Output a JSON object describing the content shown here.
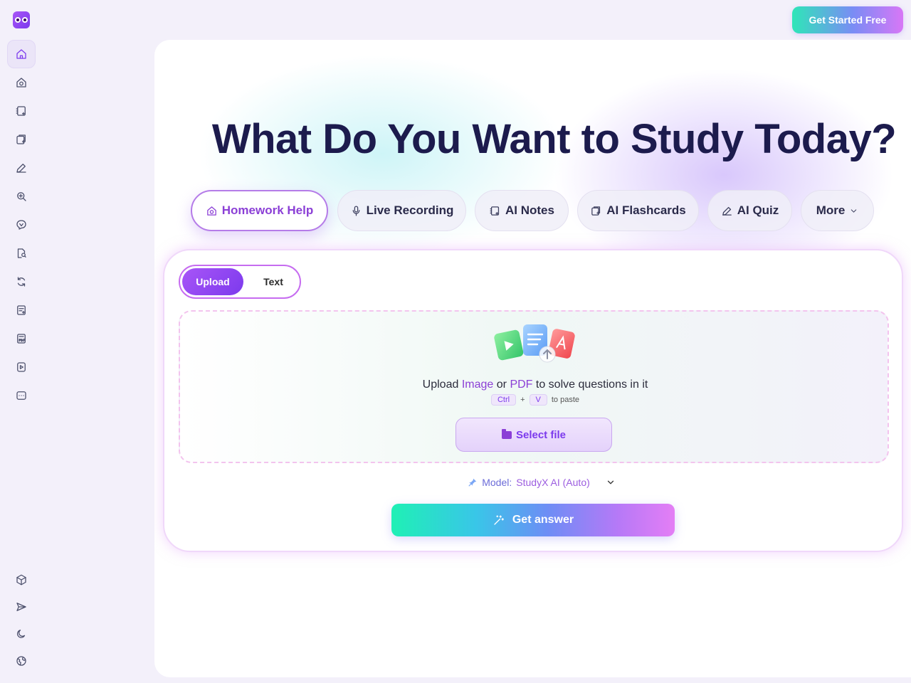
{
  "header": {
    "cta_label": "Get Started Free"
  },
  "sidebar": {
    "items": [
      {
        "icon": "home-icon",
        "active": true
      },
      {
        "icon": "homework-camera-icon"
      },
      {
        "icon": "notes-icon"
      },
      {
        "icon": "flashcards-icon"
      },
      {
        "icon": "quiz-pen-icon"
      },
      {
        "icon": "search-plus-icon"
      },
      {
        "icon": "chat-ai-icon"
      },
      {
        "icon": "document-search-icon"
      },
      {
        "icon": "refresh-icon"
      },
      {
        "icon": "essay-icon"
      },
      {
        "icon": "pdf-icon"
      },
      {
        "icon": "video-icon"
      },
      {
        "icon": "more-chat-icon"
      }
    ],
    "bottom_items": [
      {
        "icon": "cube-icon"
      },
      {
        "icon": "send-icon"
      },
      {
        "icon": "moon-icon"
      },
      {
        "icon": "language-globe-icon"
      }
    ]
  },
  "main": {
    "headline": "What Do You Want to Study Today?",
    "tabs": [
      {
        "label": "Homework Help",
        "icon": "homework-camera-icon",
        "active": true
      },
      {
        "label": "Live Recording",
        "icon": "microphone-icon"
      },
      {
        "label": "AI Notes",
        "icon": "notes-icon"
      },
      {
        "label": "AI Flashcards",
        "icon": "flashcards-icon"
      },
      {
        "label": "AI Quiz",
        "icon": "quiz-pen-icon"
      },
      {
        "label": "More",
        "icon": "chevron-down-icon"
      }
    ],
    "card": {
      "modes": {
        "upload": "Upload",
        "text": "Text"
      },
      "upload": {
        "prefix": "Upload",
        "image": "Image",
        "or": "or",
        "pdf": "PDF",
        "suffix": "to solve questions in it",
        "key1": "Ctrl",
        "plus": "+",
        "key2": "V",
        "paste_hint": "to paste",
        "select_file": "Select file"
      },
      "model": {
        "label": "Model:",
        "value": "StudyX AI (Auto)"
      },
      "submit": "Get answer"
    }
  },
  "colors": {
    "accent": "#8b3fd6",
    "headline": "#1c1b4d",
    "background": "#f3f0fa"
  }
}
